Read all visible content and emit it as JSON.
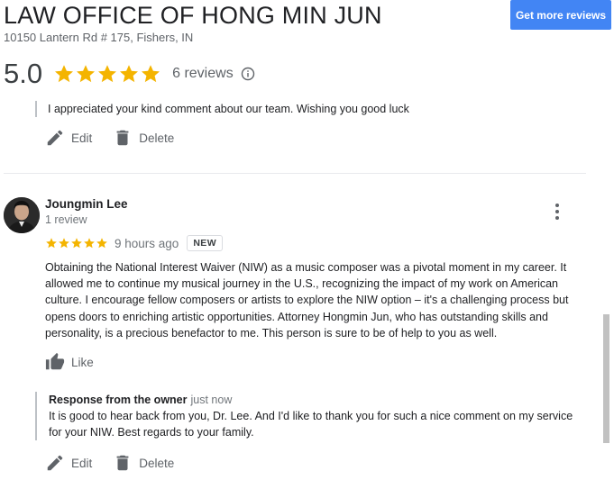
{
  "header": {
    "business_name": "LAW OFFICE OF HONG MIN JUN",
    "address": "10150 Lantern Rd # 175, Fishers, IN",
    "get_more_reviews_label": "Get more reviews"
  },
  "rating": {
    "value": "5.0",
    "stars": 5,
    "review_count_label": "6 reviews"
  },
  "previous_review": {
    "owner_reply_text": "I appreciated your kind comment about our team. Wishing you good luck",
    "edit_label": "Edit",
    "delete_label": "Delete"
  },
  "review": {
    "reviewer_name": "Joungmin Lee",
    "reviewer_review_count": "1 review",
    "stars": 5,
    "time": "9 hours ago",
    "badge": "NEW",
    "text": "Obtaining the National Interest Waiver (NIW) as a music composer was a pivotal moment in my career. It allowed me to continue my musical journey in the U.S., recognizing the impact of my work on American culture. I encourage fellow composers or artists to explore the NIW option – it's a challenging process but opens doors to enriching artistic opportunities. Attorney Hongmin Jun, who has outstanding skills and personality, is a precious benefactor to me. This person is sure to be of help to you as well.",
    "like_label": "Like",
    "owner_response": {
      "label": "Response from the owner",
      "time": "just now",
      "text": "It is good to hear back from you, Dr. Lee. And I'd like to thank you for such a nice comment on my service for your NIW. Best regards to your family."
    },
    "edit_label": "Edit",
    "delete_label": "Delete"
  },
  "colors": {
    "star": "#f4b400",
    "button": "#4285f4",
    "muted_text": "#5f6368"
  },
  "icons": [
    "star-icon",
    "info-icon",
    "edit-pencil-icon",
    "delete-trash-icon",
    "more-vert-icon",
    "thumbs-up-icon"
  ]
}
